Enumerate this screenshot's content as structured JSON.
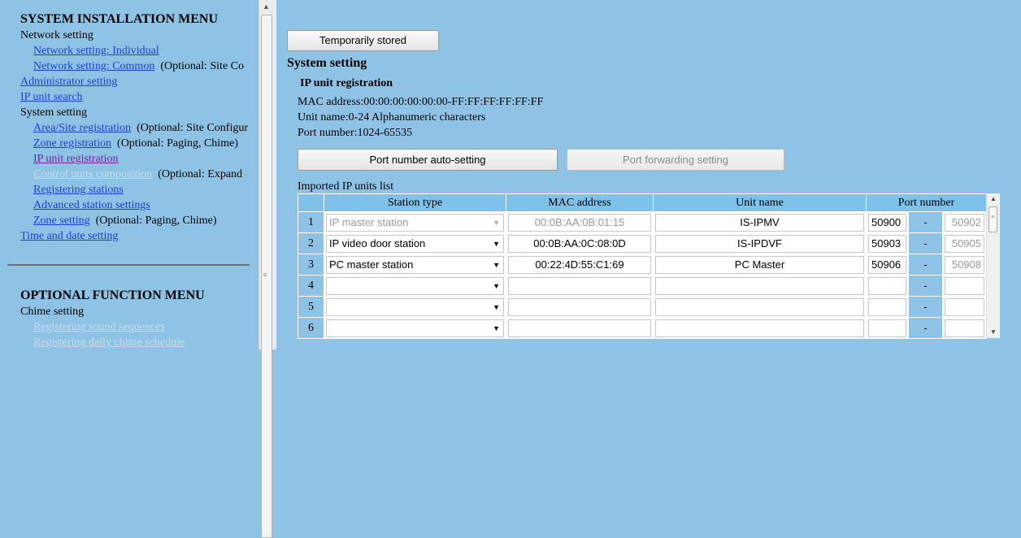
{
  "menu": {
    "install_title": "SYSTEM INSTALLATION MENU",
    "network_setting": "Network setting",
    "network_individual": "Network setting: Individual",
    "network_common": "Network setting: Common",
    "network_common_note": "(Optional: Site Co",
    "administrator_setting": "Administrator setting",
    "ip_unit_search": "IP unit search",
    "system_setting": "System setting",
    "area_site_registration": "Area/Site registration",
    "area_site_note": "(Optional: Site Configur",
    "zone_registration": "Zone registration",
    "zone_registration_note": "(Optional: Paging, Chime)",
    "ip_unit_registration": "IP unit registration",
    "control_units_composition": "Control units composition",
    "control_units_note": "(Optional: Expand",
    "registering_stations": "Registering stations",
    "advanced_station_settings": "Advanced station settings",
    "zone_setting": "Zone setting",
    "zone_setting_note": "(Optional: Paging, Chime)",
    "time_date_setting": "Time and date setting",
    "optional_title": "OPTIONAL FUNCTION MENU",
    "chime_setting": "Chime setting",
    "registering_sound_sequences": "Registering sound sequences",
    "registering_daily_chime": "Registering daily chime schedule"
  },
  "main": {
    "temp_stored_button": "Temporarily stored",
    "system_setting_heading": "System setting",
    "ip_unit_registration_heading": "IP unit registration",
    "mac_info": "MAC address:00:00:00:00:00:00-FF:FF:FF:FF:FF:FF",
    "unit_name_info": "Unit name:0-24 Alphanumeric characters",
    "port_info": "Port number:1024-65535",
    "port_auto_button": "Port number auto-setting",
    "port_forward_button": "Port forwarding setting",
    "list_caption": "Imported IP units list"
  },
  "table": {
    "headers": {
      "station_type": "Station type",
      "mac_address": "MAC address",
      "unit_name": "Unit name",
      "port_number": "Port number"
    },
    "rows": [
      {
        "no": "1",
        "station_type": "IP master station",
        "mac": "00:0B:AA:0B:01:15",
        "unit_name": "IS-IPMV",
        "port_start": "50900",
        "dash": "-",
        "port_end": "50902"
      },
      {
        "no": "2",
        "station_type": "IP video door station",
        "mac": "00:0B:AA:0C:08:0D",
        "unit_name": "IS-IPDVF",
        "port_start": "50903",
        "dash": "-",
        "port_end": "50905"
      },
      {
        "no": "3",
        "station_type": "PC master station",
        "mac": "00:22:4D:55:C1:69",
        "unit_name": "PC Master",
        "port_start": "50906",
        "dash": "-",
        "port_end": "50908"
      },
      {
        "no": "4",
        "station_type": "",
        "mac": "",
        "unit_name": "",
        "port_start": "",
        "dash": "-",
        "port_end": ""
      },
      {
        "no": "5",
        "station_type": "",
        "mac": "",
        "unit_name": "",
        "port_start": "",
        "dash": "-",
        "port_end": ""
      },
      {
        "no": "6",
        "station_type": "",
        "mac": "",
        "unit_name": "",
        "port_start": "",
        "dash": "-",
        "port_end": ""
      }
    ]
  },
  "icons": {
    "dropdown": "▼",
    "scroll_up": "▲",
    "scroll_down": "▼",
    "grip": "≡"
  }
}
